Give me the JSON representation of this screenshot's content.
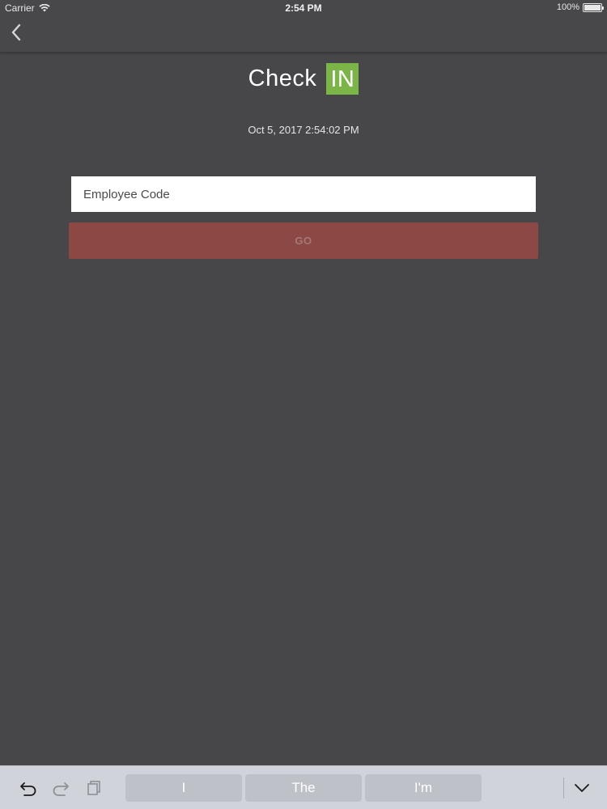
{
  "status_bar": {
    "carrier": "Carrier",
    "time": "2:54 PM",
    "battery_text": "100%",
    "battery_level": 1.0
  },
  "nav": {
    "back_icon": "chevron-left-icon"
  },
  "header": {
    "title_word": "Check",
    "title_badge": "IN",
    "badge_color": "#7bb547",
    "datetime": "Oct 5, 2017 2:54:02 PM"
  },
  "form": {
    "employee_code_placeholder": "Employee Code",
    "employee_code_value": "",
    "go_label": "GO",
    "go_color": "#8b4845"
  },
  "keyboard_bar": {
    "icons": [
      "undo-icon",
      "redo-icon",
      "paste-icon",
      "dismiss-keyboard-icon"
    ],
    "suggestions": [
      "I",
      "The",
      "I'm"
    ]
  },
  "colors": {
    "background": "#474649",
    "keyboard_bar": "#d0d3d9"
  }
}
